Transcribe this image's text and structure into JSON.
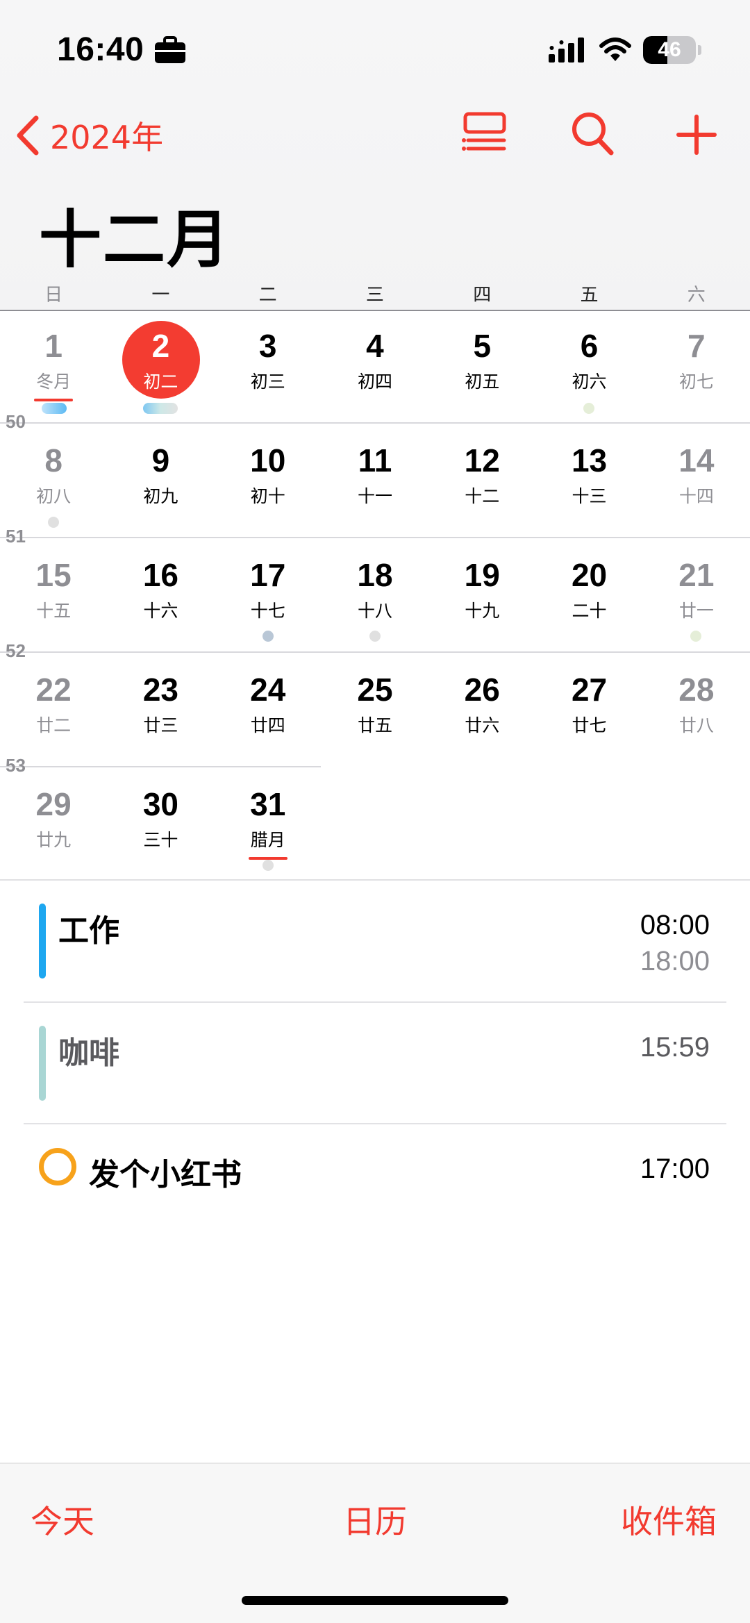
{
  "status": {
    "time": "16:40",
    "battery": "46",
    "battery_level": 0.46
  },
  "nav": {
    "back_label": "2024年"
  },
  "month_title": "十二月",
  "weekdays": [
    "日",
    "一",
    "二",
    "三",
    "四",
    "五",
    "六"
  ],
  "week_numbers": [
    "50",
    "51",
    "52",
    "53"
  ],
  "days": [
    {
      "n": "1",
      "l": "冬月"
    },
    {
      "n": "2",
      "l": "初二"
    },
    {
      "n": "3",
      "l": "初三"
    },
    {
      "n": "4",
      "l": "初四"
    },
    {
      "n": "5",
      "l": "初五"
    },
    {
      "n": "6",
      "l": "初六"
    },
    {
      "n": "7",
      "l": "初七"
    },
    {
      "n": "8",
      "l": "初八"
    },
    {
      "n": "9",
      "l": "初九"
    },
    {
      "n": "10",
      "l": "初十"
    },
    {
      "n": "11",
      "l": "十一"
    },
    {
      "n": "12",
      "l": "十二"
    },
    {
      "n": "13",
      "l": "十三"
    },
    {
      "n": "14",
      "l": "十四"
    },
    {
      "n": "15",
      "l": "十五"
    },
    {
      "n": "16",
      "l": "十六"
    },
    {
      "n": "17",
      "l": "十七"
    },
    {
      "n": "18",
      "l": "十八"
    },
    {
      "n": "19",
      "l": "十九"
    },
    {
      "n": "20",
      "l": "二十"
    },
    {
      "n": "21",
      "l": "廿一"
    },
    {
      "n": "22",
      "l": "廿二"
    },
    {
      "n": "23",
      "l": "廿三"
    },
    {
      "n": "24",
      "l": "廿四"
    },
    {
      "n": "25",
      "l": "廿五"
    },
    {
      "n": "26",
      "l": "廿六"
    },
    {
      "n": "27",
      "l": "廿七"
    },
    {
      "n": "28",
      "l": "廿八"
    },
    {
      "n": "29",
      "l": "廿九"
    },
    {
      "n": "30",
      "l": "三十"
    },
    {
      "n": "31",
      "l": "腊月"
    }
  ],
  "events": [
    {
      "title": "工作",
      "start": "08:00",
      "end": "18:00",
      "color": "#1ea7f0"
    },
    {
      "title": "咖啡",
      "start": "15:59",
      "color": "#a9d6d4"
    },
    {
      "title": "发个小红书",
      "start": "17:00",
      "color": "#f7a21b"
    }
  ],
  "tabs": {
    "today": "今天",
    "calendars": "日历",
    "inbox": "收件箱"
  },
  "colors": {
    "accent": "#f23a2f"
  }
}
